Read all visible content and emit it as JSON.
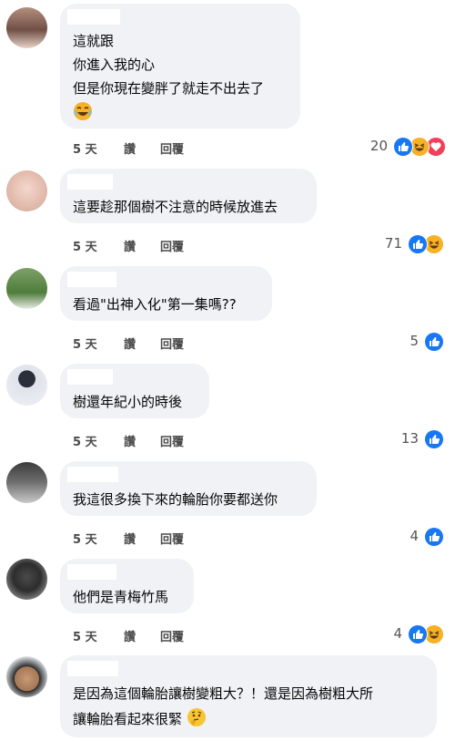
{
  "comments": [
    {
      "lines": [
        "這就跟",
        "你進入我的心",
        "但是你現在變胖了就走不出去了"
      ],
      "emoji": "laughing-emoji",
      "time": "5 天",
      "read": "讚",
      "reply": "回覆",
      "count": "20",
      "reactions": [
        "like",
        "haha",
        "love"
      ]
    },
    {
      "lines": [
        "這要趁那個樹不注意的時候放進去"
      ],
      "time": "5 天",
      "read": "讚",
      "reply": "回覆",
      "count": "71",
      "reactions": [
        "like",
        "haha"
      ]
    },
    {
      "lines": [
        "看過\"出神入化\"第一集嗎??"
      ],
      "time": "5 天",
      "read": "讚",
      "reply": "回覆",
      "count": "5",
      "reactions": [
        "like"
      ]
    },
    {
      "lines": [
        "樹還年紀小的時後"
      ],
      "time": "5 天",
      "read": "讚",
      "reply": "回覆",
      "count": "13",
      "reactions": [
        "like"
      ]
    },
    {
      "lines": [
        "我這很多換下來的輪胎你要都送你"
      ],
      "time": "5 天",
      "read": "讚",
      "reply": "回覆",
      "count": "4",
      "reactions": [
        "like"
      ]
    },
    {
      "lines": [
        "他們是青梅竹馬"
      ],
      "time": "5 天",
      "read": "讚",
      "reply": "回覆",
      "count": "4",
      "reactions": [
        "like",
        "haha"
      ]
    },
    {
      "lines": [
        "是因為這個輪胎讓樹變粗大？！還是因為樹粗大所",
        "讓輪胎看起來很緊"
      ],
      "emoji": "thinking-emoji"
    }
  ],
  "colors": {
    "like": "#1877f2",
    "love": "#f33e58",
    "haha": "#f7b125",
    "bubble": "#f0f2f5"
  }
}
